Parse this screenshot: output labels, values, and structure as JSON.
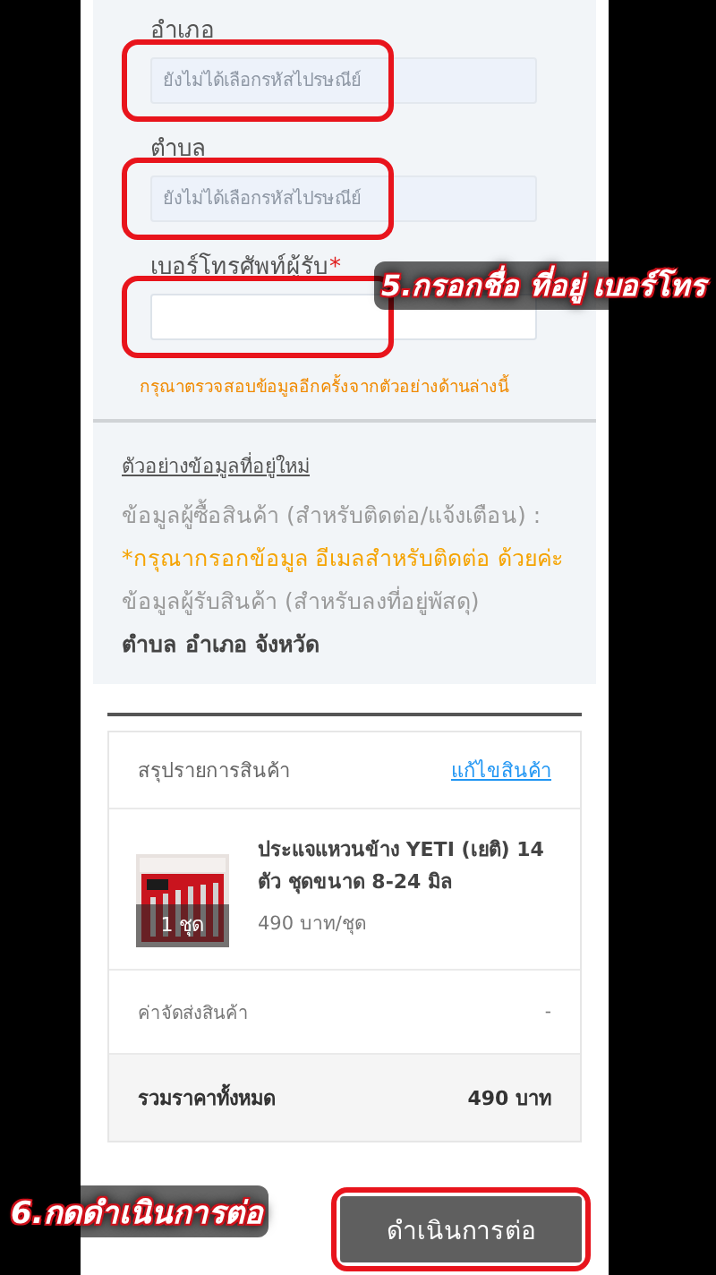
{
  "form": {
    "fields": [
      {
        "label": "อำเภอ",
        "placeholder": "ยังไม่ได้เลือกรหัสไปรษณีย์",
        "disabled": true,
        "highlighted": true
      },
      {
        "label": "ตำบล",
        "placeholder": "ยังไม่ได้เลือกรหัสไปรษณีย์",
        "disabled": true,
        "highlighted": true
      },
      {
        "label": "เบอร์โทรศัพท์ผู้รับ",
        "required_mark": "*",
        "disabled": false,
        "highlighted": true
      }
    ],
    "hint": "กรุณาตรวจสอบข้อมูลอีกครั้งจากตัวอย่างด้านล่างนี้"
  },
  "example": {
    "title": "ตัวอย่างข้อมูลที่อยู่ใหม่",
    "lines": [
      {
        "kind": "muted",
        "text": "ข้อมูลผู้ซื้อสินค้า (สำหรับติดต่อ/แจ้งเตือน) :"
      },
      {
        "kind": "warning",
        "text": "*กรุณากรอกข้อมูล อีเมลสำหรับติดต่อ ด้วยค่ะ"
      },
      {
        "kind": "muted",
        "text": "ข้อมูลผู้รับสินค้า (สำหรับลงที่อยู่พัสดุ)"
      },
      {
        "kind": "strong",
        "text": "ตำบล อำเภอ จังหวัด"
      }
    ]
  },
  "summary": {
    "title": "สรุปรายการสินค้า",
    "edit_link": "แก้ไขสินค้า",
    "item": {
      "quantity": "1 ชุด",
      "name": "ประแจแหวนข้าง YETI (เยติ) 14 ตัว ชุดขนาด 8-24 มิล",
      "price": "490 บาท/ชุด"
    },
    "shipping": {
      "label": "ค่าจัดส่งสินค้า",
      "value": "-"
    },
    "total": {
      "label": "รวมราคาทั้งหมด",
      "value": "490 บาท"
    }
  },
  "proceed_button": {
    "label": "ดำเนินการต่อ",
    "highlighted": true
  },
  "annotations": [
    {
      "kind": "form",
      "text": "5.กรอกชื่อ ที่อยู่ เบอร์โทร"
    },
    {
      "kind": "button",
      "text": "6.กดดำเนินการต่อ"
    }
  ]
}
